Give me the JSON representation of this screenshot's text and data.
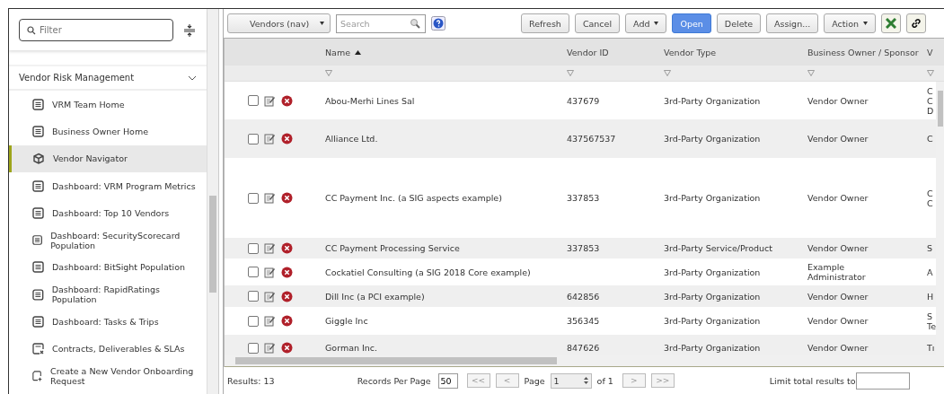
{
  "sidebar": {
    "filter": {
      "placeholder": "Filter"
    },
    "section": {
      "title": "Vendor Risk Management",
      "expanded": true
    },
    "items": [
      {
        "label": "VRM Team Home",
        "kind": "page",
        "selected": false
      },
      {
        "label": "Business Owner Home",
        "kind": "page",
        "selected": false
      },
      {
        "label": "Vendor Navigator",
        "kind": "navigator",
        "selected": true
      },
      {
        "label": "Dashboard: VRM Program Metrics",
        "kind": "page",
        "selected": false
      },
      {
        "label": "Dashboard: Top 10 Vendors",
        "kind": "page",
        "selected": false
      },
      {
        "label": "Dashboard: SecurityScorecard Population",
        "kind": "page",
        "selected": false
      },
      {
        "label": "Dashboard: BitSight Population",
        "kind": "page",
        "selected": false
      },
      {
        "label": "Dashboard: RapidRatings Population",
        "kind": "page",
        "selected": false
      },
      {
        "label": "Dashboard: Tasks & Trips",
        "kind": "page",
        "selected": false
      },
      {
        "label": "Contracts, Deliverables & SLAs",
        "kind": "contract",
        "selected": false
      },
      {
        "label": "Create a New Vendor Onboarding Request",
        "kind": "create",
        "selected": false
      }
    ]
  },
  "toolbar": {
    "view": "Vendors (nav)",
    "search": {
      "placeholder": "Search"
    },
    "buttons": [
      {
        "label": "Refresh",
        "kind": "plain"
      },
      {
        "label": "Cancel",
        "kind": "plain"
      },
      {
        "label": "Add",
        "kind": "menu"
      },
      {
        "label": "Open",
        "kind": "primary"
      },
      {
        "label": "Delete",
        "kind": "plain"
      },
      {
        "label": "Assign...",
        "kind": "plain"
      },
      {
        "label": "Action",
        "kind": "menu"
      }
    ]
  },
  "table": {
    "columns": [
      {
        "label": "Name",
        "sorted": true
      },
      {
        "label": "Vendor ID",
        "sorted": false
      },
      {
        "label": "Vendor Type",
        "sorted": false
      },
      {
        "label": "Business Owner / Sponsor",
        "sorted": false
      },
      {
        "label": "V",
        "sorted": false
      }
    ],
    "rows": [
      {
        "checked": false,
        "cells": [
          "Abou-Merhi Lines Sal",
          "437679",
          "3rd-Party Organization",
          "Vendor Owner",
          "C\nC\nD"
        ]
      },
      {
        "checked": false,
        "cells": [
          "Alliance Ltd.",
          "437567537",
          "3rd-Party Organization",
          "Vendor Owner",
          "C"
        ]
      },
      {
        "checked": false,
        "cells": [
          "CC Payment Inc. (a SIG aspects example)",
          "337853",
          "3rd-Party Organization",
          "Vendor Owner",
          "C\nC"
        ]
      },
      {
        "checked": false,
        "cells": [
          "CC Payment Processing Service",
          "337853",
          "3rd-Party Service/Product",
          "Vendor Owner",
          "S"
        ]
      },
      {
        "checked": false,
        "cells": [
          "Cockatiel Consulting (a SIG 2018 Core example)",
          "",
          "3rd-Party Organization",
          "Example\nAdministrator",
          "A"
        ]
      },
      {
        "checked": false,
        "cells": [
          "Dill Inc (a PCI example)",
          "642856",
          "3rd-Party Organization",
          "Vendor Owner",
          "H"
        ]
      },
      {
        "checked": false,
        "cells": [
          "Giggle Inc",
          "356345",
          "3rd-Party Organization",
          "Vendor Owner",
          "S\nTe"
        ]
      },
      {
        "checked": false,
        "cells": [
          "Gorman Inc.",
          "847626",
          "3rd-Party Organization",
          "Vendor Owner",
          "Tı"
        ]
      }
    ]
  },
  "footer": {
    "results": "Results: 13",
    "records_label": "Records Per Page",
    "records": "50",
    "first": "<<",
    "prev": "<",
    "page_label": "Page",
    "page": "1",
    "of": "of 1",
    "next": ">",
    "last": ">>",
    "limit_label": "Limit total results to"
  }
}
